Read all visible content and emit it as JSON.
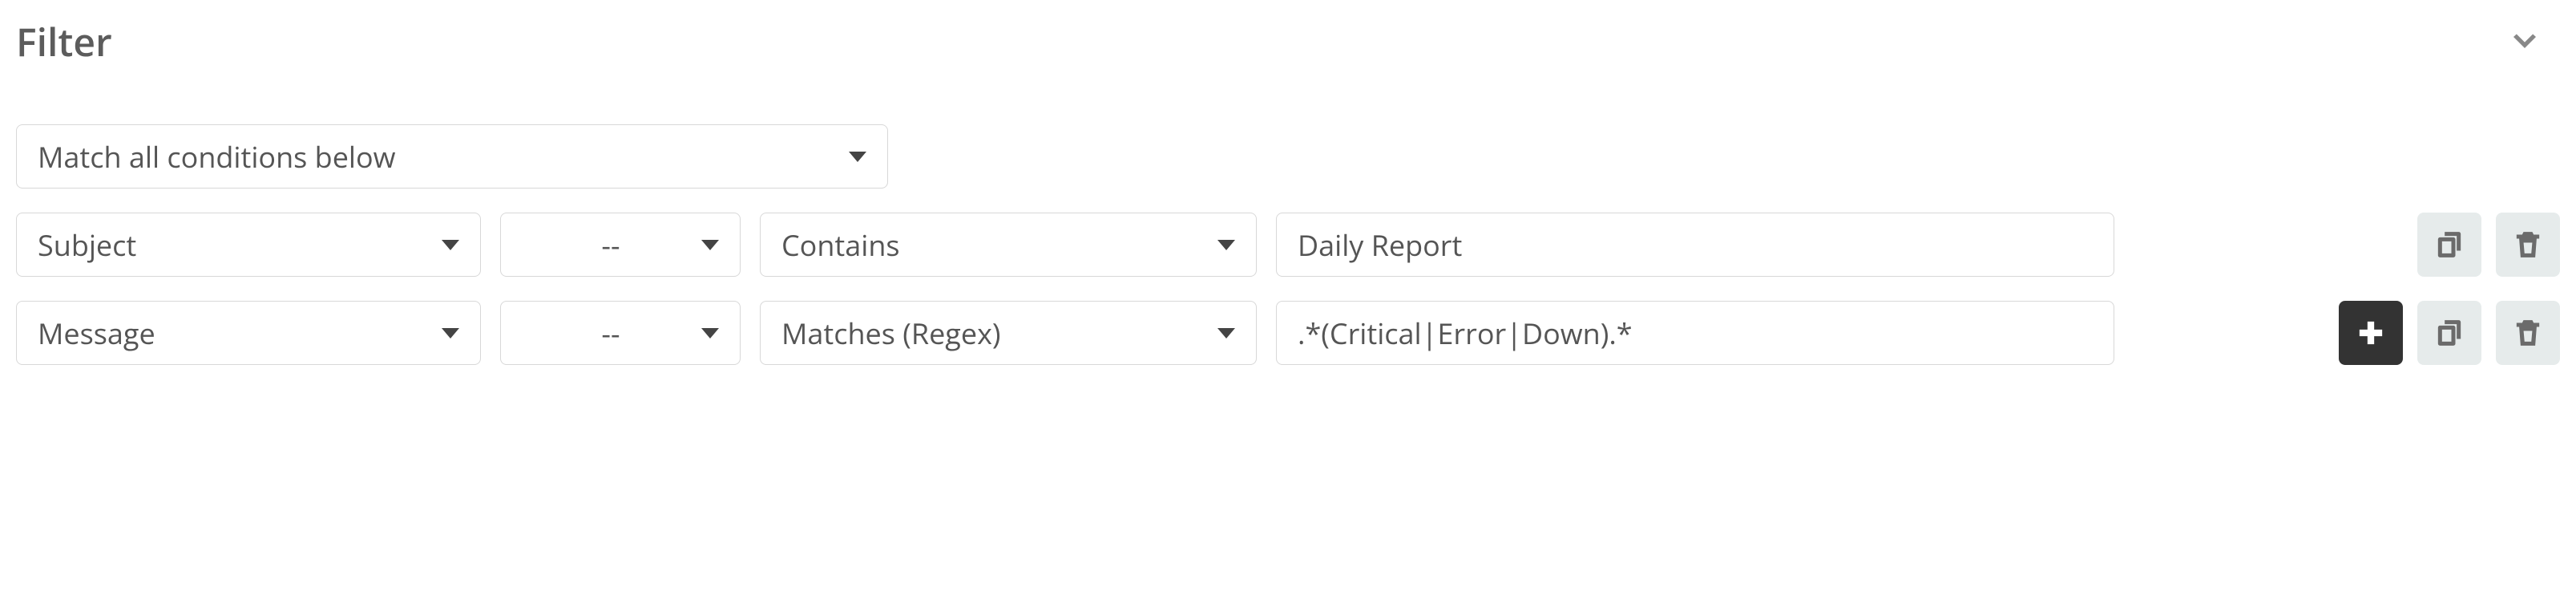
{
  "header": {
    "title": "Filter"
  },
  "match_mode": "Match all conditions below",
  "rows": [
    {
      "field": "Subject",
      "modifier": "--",
      "operator": "Contains",
      "value": "Daily Report",
      "show_add": false
    },
    {
      "field": "Message",
      "modifier": "--",
      "operator": "Matches (Regex)",
      "value": ".*(Critical|Error|Down).*",
      "show_add": true
    }
  ]
}
